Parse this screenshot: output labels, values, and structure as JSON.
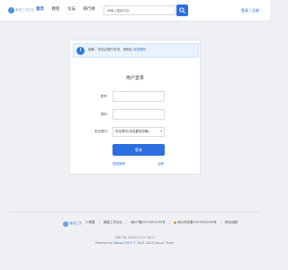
{
  "header": {
    "logo_text": "鼎维工坊社区",
    "nav": [
      {
        "label": "首页",
        "active": true
      },
      {
        "label": "教程",
        "active": false
      },
      {
        "label": "论坛",
        "active": false
      },
      {
        "label": "排行榜",
        "active": false
      }
    ],
    "search_placeholder": "请输入搜索内容",
    "login_label": "登录",
    "auth_separator": "|",
    "register_label": "注册"
  },
  "notice": {
    "icon": "!",
    "text": "抱歉，本站点暂时关闭，请稍后",
    "link_text": "安全提问"
  },
  "login_form": {
    "title": "用户登录",
    "username_label": "账号:",
    "password_label": "密码:",
    "question_label": "安全提问:",
    "question_value": "安全提问(未设置请忽略)",
    "submit_label": "登录",
    "forgot_label": "找回密码",
    "register_label": "注册"
  },
  "footer": {
    "logo_text": "鼎维工坊",
    "links": [
      "小黑屋",
      "鼎维工坊论坛",
      "闽ICP备2023004290号",
      "闽公网安备2023004290号",
      "网站地图"
    ],
    "status_line": "GMT+8, 2024-11-22 16:12",
    "powered_prefix": "Powered by ",
    "powered_brand": "Discuz! X3.5",
    "copyright": "© 2001-2024 Discuz! Team."
  },
  "colors": {
    "accent": "#2b6fe0",
    "link": "#1e64c8",
    "background": "#eef0f4",
    "notice_bg": "#eaf3fd"
  }
}
